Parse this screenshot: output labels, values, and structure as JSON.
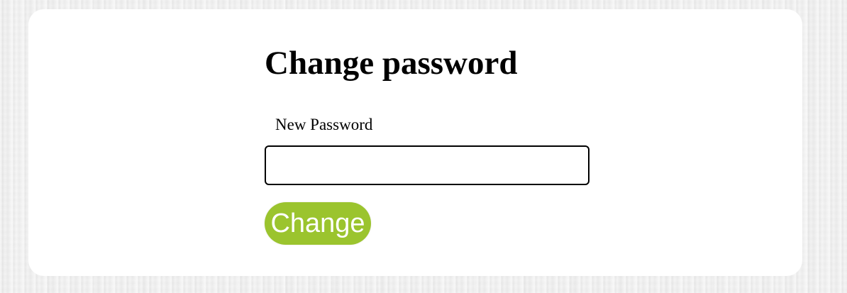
{
  "page": {
    "title": "Change password"
  },
  "form": {
    "new_password_label": "New Password",
    "new_password_value": "",
    "new_password_placeholder": "",
    "submit_label": "Change"
  },
  "colors": {
    "button_background": "#9bc42e",
    "button_text": "#ffffff",
    "card_background": "#ffffff",
    "input_border": "#000000"
  }
}
